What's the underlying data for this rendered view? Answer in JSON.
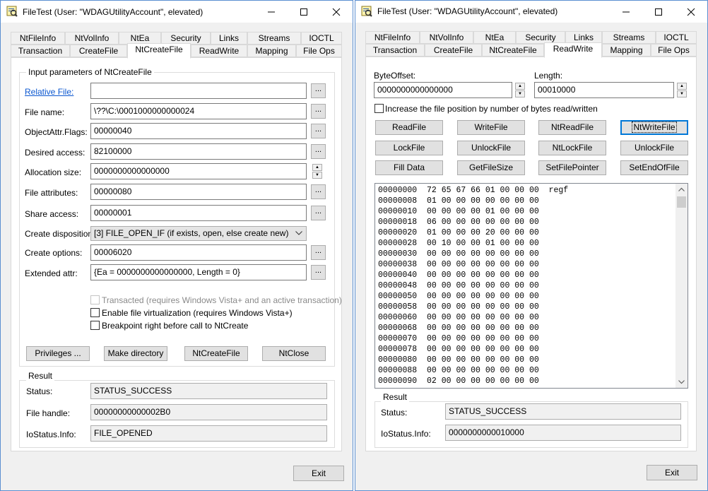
{
  "colors": {
    "window_border": "#5b8fd1",
    "link": "#0b57d0",
    "focus": "#0078d7"
  },
  "left": {
    "title": "FileTest (User: \"WDAGUtilityAccount\", elevated)",
    "tabs_row1": [
      "NtFileInfo",
      "NtVolInfo",
      "NtEa",
      "Security",
      "Links",
      "Streams",
      "IOCTL"
    ],
    "tabs_row2": [
      "Transaction",
      "CreateFile",
      "NtCreateFile",
      "ReadWrite",
      "Mapping",
      "File Ops"
    ],
    "active_tab": "NtCreateFile",
    "input_group_title": "Input parameters of NtCreateFile",
    "fields": [
      {
        "label": "Relative File:",
        "value": ""
      },
      {
        "label": "File name:",
        "value": "\\??\\C:\\0001000000000024"
      },
      {
        "label": "ObjectAttr.Flags:",
        "value": "00000040"
      },
      {
        "label": "Desired access:",
        "value": "82100000"
      },
      {
        "label": "Allocation size:",
        "value": "0000000000000000"
      },
      {
        "label": "File attributes:",
        "value": "00000080"
      },
      {
        "label": "Share access:",
        "value": "00000001"
      },
      {
        "label": "Create disposition:",
        "value": "[3] FILE_OPEN_IF (if exists, open, else create new)"
      },
      {
        "label": "Create options:",
        "value": "00006020"
      },
      {
        "label": "Extended attr:",
        "value": "{Ea = 0000000000000000, Length = 0}"
      }
    ],
    "dots_label": "...",
    "checkboxes": [
      {
        "label": "Transacted (requires Windows Vista+ and an active transaction)",
        "checked": false,
        "enabled": false
      },
      {
        "label": "Enable file virtualization (requires Windows Vista+)",
        "checked": false,
        "enabled": true
      },
      {
        "label": "Breakpoint right before call to NtCreate",
        "checked": false,
        "enabled": true
      }
    ],
    "buttons": [
      "Privileges ...",
      "Make directory",
      "NtCreateFile",
      "NtClose"
    ],
    "result_title": "Result",
    "results": [
      {
        "label": "Status:",
        "value": "STATUS_SUCCESS"
      },
      {
        "label": "File handle:",
        "value": "00000000000002B0"
      },
      {
        "label": "IoStatus.Info:",
        "value": "FILE_OPENED"
      }
    ],
    "exit": "Exit"
  },
  "right": {
    "title": "FileTest (User: \"WDAGUtilityAccount\", elevated)",
    "tabs_row1": [
      "NtFileInfo",
      "NtVolInfo",
      "NtEa",
      "Security",
      "Links",
      "Streams",
      "IOCTL"
    ],
    "tabs_row2": [
      "Transaction",
      "CreateFile",
      "NtCreateFile",
      "ReadWrite",
      "Mapping",
      "File Ops"
    ],
    "active_tab": "ReadWrite",
    "offset_label": "ByteOffset:",
    "offset_value": "0000000000000000",
    "length_label": "Length:",
    "length_value": "00010000",
    "increase_label": "Increase the file position by number of bytes read/written",
    "increase_checked": false,
    "buttons": [
      [
        "ReadFile",
        "WriteFile",
        "NtReadFile",
        "NtWriteFile"
      ],
      [
        "LockFile",
        "UnlockFile",
        "NtLockFile",
        "UnlockFile"
      ],
      [
        "Fill Data",
        "GetFileSize",
        "SetFilePointer",
        "SetEndOfFile"
      ]
    ],
    "focused_button": "NtWriteFile",
    "hex_rows": [
      {
        "offset": "00000000",
        "bytes": "72 65 67 66 01 00 00 00",
        "ascii": "regf"
      },
      {
        "offset": "00000008",
        "bytes": "01 00 00 00 00 00 00 00",
        "ascii": ""
      },
      {
        "offset": "00000010",
        "bytes": "00 00 00 00 01 00 00 00",
        "ascii": ""
      },
      {
        "offset": "00000018",
        "bytes": "06 00 00 00 00 00 00 00",
        "ascii": ""
      },
      {
        "offset": "00000020",
        "bytes": "01 00 00 00 20 00 00 00",
        "ascii": ""
      },
      {
        "offset": "00000028",
        "bytes": "00 10 00 00 01 00 00 00",
        "ascii": ""
      },
      {
        "offset": "00000030",
        "bytes": "00 00 00 00 00 00 00 00",
        "ascii": ""
      },
      {
        "offset": "00000038",
        "bytes": "00 00 00 00 00 00 00 00",
        "ascii": ""
      },
      {
        "offset": "00000040",
        "bytes": "00 00 00 00 00 00 00 00",
        "ascii": ""
      },
      {
        "offset": "00000048",
        "bytes": "00 00 00 00 00 00 00 00",
        "ascii": ""
      },
      {
        "offset": "00000050",
        "bytes": "00 00 00 00 00 00 00 00",
        "ascii": ""
      },
      {
        "offset": "00000058",
        "bytes": "00 00 00 00 00 00 00 00",
        "ascii": ""
      },
      {
        "offset": "00000060",
        "bytes": "00 00 00 00 00 00 00 00",
        "ascii": ""
      },
      {
        "offset": "00000068",
        "bytes": "00 00 00 00 00 00 00 00",
        "ascii": ""
      },
      {
        "offset": "00000070",
        "bytes": "00 00 00 00 00 00 00 00",
        "ascii": ""
      },
      {
        "offset": "00000078",
        "bytes": "00 00 00 00 00 00 00 00",
        "ascii": ""
      },
      {
        "offset": "00000080",
        "bytes": "00 00 00 00 00 00 00 00",
        "ascii": ""
      },
      {
        "offset": "00000088",
        "bytes": "00 00 00 00 00 00 00 00",
        "ascii": ""
      },
      {
        "offset": "00000090",
        "bytes": "02 00 00 00 00 00 00 00",
        "ascii": ""
      }
    ],
    "result_title": "Result",
    "results": [
      {
        "label": "Status:",
        "value": "STATUS_SUCCESS"
      },
      {
        "label": "IoStatus.Info:",
        "value": "0000000000010000"
      }
    ],
    "exit": "Exit"
  }
}
